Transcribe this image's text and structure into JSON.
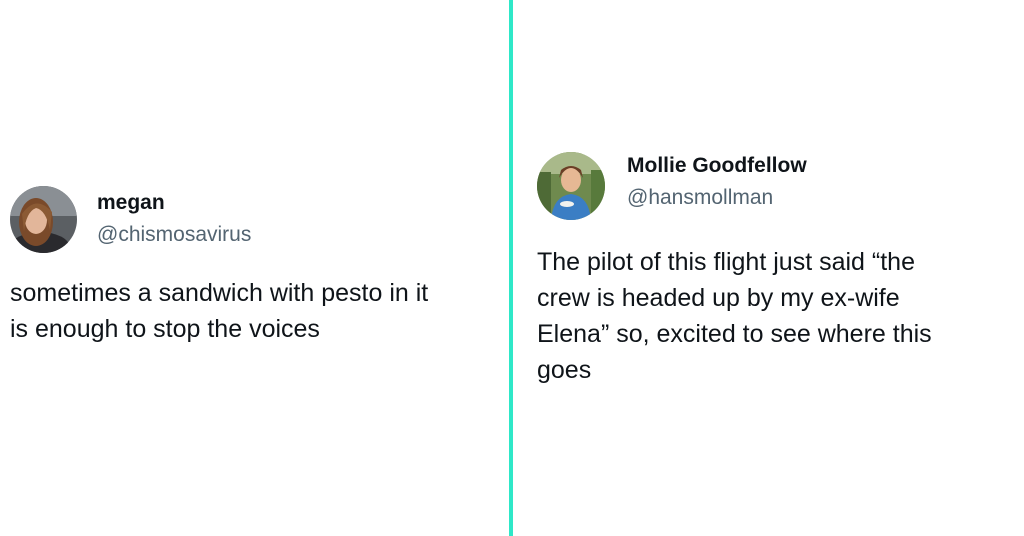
{
  "divider_color": "#2ee8c8",
  "tweets": [
    {
      "display_name": "megan",
      "handle": "@chismosavirus",
      "text_lines": [
        "sometimes a sandwich with pesto in it",
        "is enough to stop the voices"
      ]
    },
    {
      "display_name": "Mollie Goodfellow",
      "handle": "@hansmollman",
      "text_lines": [
        "The pilot of this flight just said “the",
        "crew is headed up by my ex-wife",
        "Elena” so, excited to see where this",
        "goes"
      ]
    }
  ]
}
